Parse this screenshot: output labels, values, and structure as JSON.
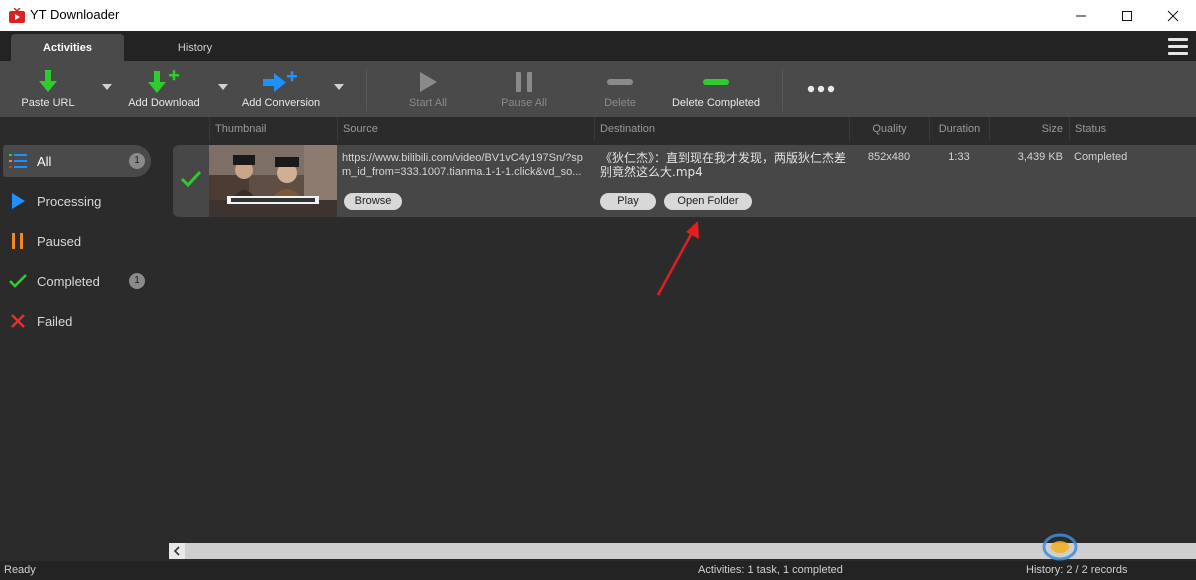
{
  "window": {
    "title": "YT Downloader"
  },
  "tabs": [
    {
      "label": "Activities",
      "active": true
    },
    {
      "label": "History",
      "active": false
    }
  ],
  "toolbar": {
    "paste_url": "Paste URL",
    "add_download": "Add Download",
    "add_conversion": "Add Conversion",
    "start_all": "Start All",
    "pause_all": "Pause All",
    "delete": "Delete",
    "delete_completed": "Delete Completed"
  },
  "columns": {
    "thumbnail": "Thumbnail",
    "source": "Source",
    "destination": "Destination",
    "quality": "Quality",
    "duration": "Duration",
    "size": "Size",
    "status": "Status"
  },
  "sidebar": {
    "items": [
      {
        "label": "All",
        "count": "1",
        "icon": "list-icon"
      },
      {
        "label": "Processing",
        "count": "",
        "icon": "play-icon"
      },
      {
        "label": "Paused",
        "count": "",
        "icon": "pause-icon"
      },
      {
        "label": "Completed",
        "count": "1",
        "icon": "check-icon"
      },
      {
        "label": "Failed",
        "count": "",
        "icon": "x-icon"
      }
    ]
  },
  "task": {
    "source": "https://www.bilibili.com/video/BV1vC4y197Sn/?spm_id_from=333.1007.tianma.1-1-1.click&vd_so...",
    "destination": "《狄仁杰》：直到现在我才发现，两版狄仁杰差别竟然这么大.mp4",
    "quality": "852x480",
    "duration": "1:33",
    "size": "3,439 KB",
    "status": "Completed",
    "browse_label": "Browse",
    "play_label": "Play",
    "open_folder_label": "Open Folder"
  },
  "statusbar": {
    "ready": "Ready",
    "activities": "Activities: 1 task, 1 completed",
    "history": "History: 2 / 2 records"
  },
  "colors": {
    "green": "#2ecc2e",
    "blue": "#1e90ff",
    "orange": "#f08a1c",
    "red": "#e03030",
    "accent_arrow": "#e02020"
  }
}
